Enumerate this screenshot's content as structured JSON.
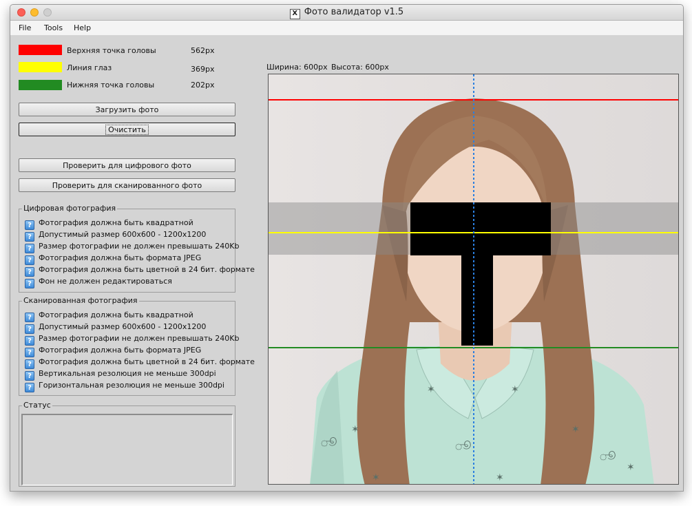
{
  "window": {
    "title": "Фото валидатор v1.5"
  },
  "menu": [
    "File",
    "Tools",
    "Help"
  ],
  "legend": [
    {
      "label": "Верхняя точка головы",
      "value": "562px",
      "color": "#ff0000"
    },
    {
      "label": "Линия глаз",
      "value": "369px",
      "color": "#ffff00"
    },
    {
      "label": "Нижняя точка головы",
      "value": "202px",
      "color": "#228b22"
    }
  ],
  "buttons": {
    "load": "Загрузить фото",
    "clear": "Очистить",
    "check_digital": "Проверить для цифрового фото",
    "check_scanned": "Проверить для сканированного фото"
  },
  "digital": {
    "title": "Цифровая фотография",
    "rules": [
      "Фотография должна быть квадратной",
      "Допустимый размер 600х600 - 1200х1200",
      "Размер фотографии не должен превышать 240Kb",
      "Фотография должна быть формата JPEG",
      "Фотография должна быть цветной в 24 бит. формате",
      "Фон не должен редактироваться"
    ]
  },
  "scanned": {
    "title": "Сканированная фотография",
    "rules": [
      "Фотография должна быть квадратной",
      "Допустимый размер 600х600 - 1200х1200",
      "Размер фотографии не должен превышать 240Kb",
      "Фотография должна быть формата JPEG",
      "Фотография должна быть цветной в 24 бит. формате",
      "Вертикальная резолюция не меньше 300dpi",
      "Горизонтальная резолюция не меньше 300dpi"
    ]
  },
  "status": {
    "title": "Статус"
  },
  "photo": {
    "width_label": "Ширина: 600px",
    "height_label": "Высота: 600px"
  }
}
